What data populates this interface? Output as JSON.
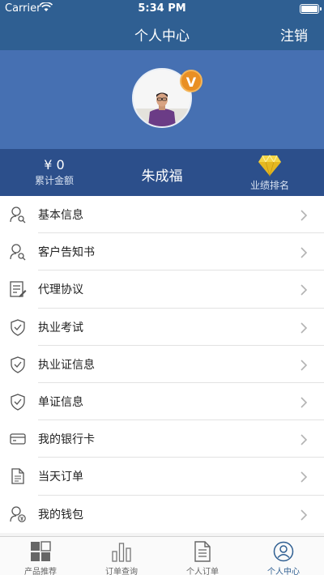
{
  "status_bar": {
    "carrier": "Carrier",
    "time": "5:34 PM"
  },
  "nav": {
    "title": "个人中心",
    "logout": "注销"
  },
  "profile": {
    "badge": "V"
  },
  "stats": {
    "amount": "¥ 0",
    "amount_label": "累计金额",
    "name": "朱成福",
    "rank_label": "业绩排名"
  },
  "menu": {
    "items": [
      {
        "label": "基本信息",
        "icon": "user-search-icon"
      },
      {
        "label": "客户告知书",
        "icon": "user-search-icon"
      },
      {
        "label": "代理协议",
        "icon": "document-edit-icon"
      },
      {
        "label": "执业考试",
        "icon": "shield-check-icon"
      },
      {
        "label": "执业证信息",
        "icon": "shield-check-icon"
      },
      {
        "label": "单证信息",
        "icon": "shield-check-icon"
      },
      {
        "label": "我的银行卡",
        "icon": "credit-card-icon"
      },
      {
        "label": "当天订单",
        "icon": "document-icon"
      },
      {
        "label": "我的钱包",
        "icon": "user-wallet-icon"
      }
    ]
  },
  "tabs": [
    {
      "label": "产品推荐",
      "icon": "grid-icon"
    },
    {
      "label": "订单查询",
      "icon": "bar-chart-icon"
    },
    {
      "label": "个人订单",
      "icon": "document-icon"
    },
    {
      "label": "个人中心",
      "icon": "user-circle-icon",
      "active": true
    }
  ],
  "colors": {
    "primary": "#2f5f92",
    "profile_bg": "#4670b2",
    "stats_bg": "#2c4f8b",
    "badge": "#e98f23"
  }
}
